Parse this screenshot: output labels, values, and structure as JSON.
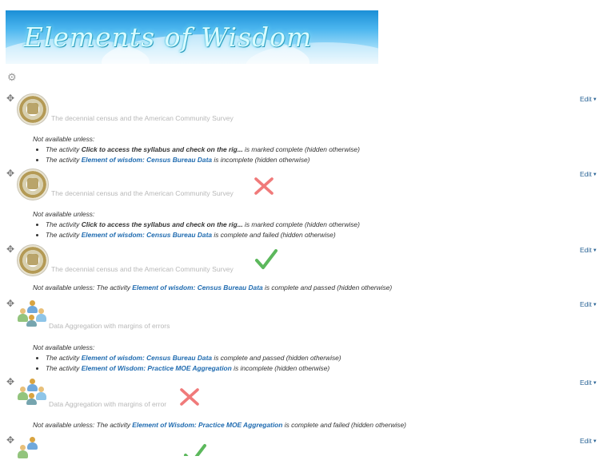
{
  "banner": {
    "title": "Elements of Wisdom"
  },
  "edit_label": "Edit",
  "activities": {
    "a1": {
      "title": "The decennial census and the American Community Survey",
      "cond_label": "Not available unless:",
      "c1_pre": "The activity ",
      "c1_link": "Click to access the syllabus and check on the rig...",
      "c1_post": " is marked complete (hidden otherwise)",
      "c2_pre": "The activity ",
      "c2_link": "Element of wisdom: Census Bureau Data",
      "c2_post": " is incomplete (hidden otherwise)"
    },
    "a2": {
      "title": "The decennial census and the American Community Survey",
      "status": "cross",
      "cond_label": "Not available unless:",
      "c1_pre": "The activity ",
      "c1_link": "Click to access the syllabus and check on the rig...",
      "c1_post": " is marked complete (hidden otherwise)",
      "c2_pre": "The activity ",
      "c2_link": "Element of wisdom: Census Bureau Data",
      "c2_post": " is complete and failed (hidden otherwise)"
    },
    "a3": {
      "title": "The decennial census and the American Community Survey",
      "status": "check",
      "cond_pre": "Not available unless: The activity ",
      "cond_link": "Element of wisdom: Census Bureau Data",
      "cond_post": " is complete and passed (hidden otherwise)"
    },
    "a4": {
      "title": "Data Aggregation with margins of errors",
      "cond_label": "Not available unless:",
      "c1_pre": "The activity ",
      "c1_link": "Element of wisdom: Census Bureau Data",
      "c1_post": " is complete and passed (hidden otherwise)",
      "c2_pre": "The activity ",
      "c2_link": "Element of Wisdom: Practice MOE Aggregation",
      "c2_post": " is incomplete (hidden otherwise)"
    },
    "a5": {
      "title": "Data Aggregation with margins of error",
      "status": "cross",
      "cond_pre": "Not available unless: The activity ",
      "cond_link": "Element of Wisdom: Practice MOE Aggregation",
      "cond_post": " is complete and failed (hidden otherwise)"
    },
    "a6": {
      "status": "check"
    }
  },
  "colors": {
    "link": "#1f6bb0",
    "cross": "#f07a7a",
    "check": "#5cb85c",
    "dimmed": "#b8b8b8"
  }
}
